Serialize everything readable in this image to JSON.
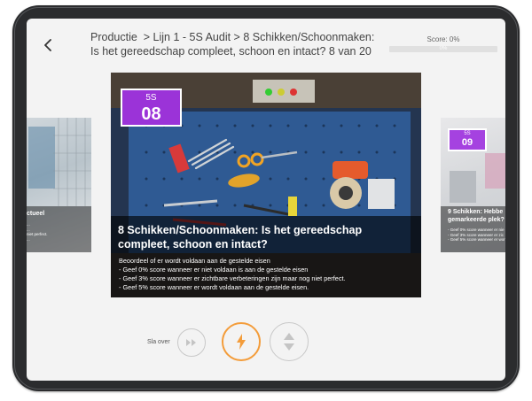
{
  "header": {
    "title_line1": "Productie  > Lijn 1 - 5S Audit > 8 Schikken/Schoonmaken:",
    "title_line2": "Is het gereedschap compleet, schoon en intact? 8 van 20",
    "score_label": "Score: 0%",
    "score_bar_text": "0%",
    "score_value": 0
  },
  "left_card": {
    "title": "ctueel",
    "desc": [
      "...",
      "...",
      "niet perfect.",
      "..."
    ]
  },
  "current_card": {
    "badge_top": "5S",
    "badge_number": "08",
    "title": "8 Schikken/Schoonmaken: Is het gereedschap compleet, schoon en intact?",
    "desc_lines": [
      "Beoordeel of er wordt voldaan aan de gestelde eisen",
      "- Geef 0% score wanneer er niet voldaan is aan de gestelde eisen",
      "- Geef 3% score wanneer er zichtbare verbeteringen zijn maar nog niet perfect.",
      "- Geef 5% score wanneer er wordt voldaan aan de gestelde eisen."
    ]
  },
  "right_card": {
    "badge_top": "5S",
    "badge_number": "09",
    "title_line1": "9 Schikken: Hebbe",
    "title_line2": "gemarkeerde plek?",
    "desc": [
      "- Geef 0% score wanneer er nie",
      "- Geef 3% score wanneer er zic",
      "- Geef 5% score wanneer er wor"
    ]
  },
  "controls": {
    "skip_label": "Sla over"
  },
  "colors": {
    "accent_purple": "#9b33d8",
    "accent_orange": "#f39c3a"
  }
}
